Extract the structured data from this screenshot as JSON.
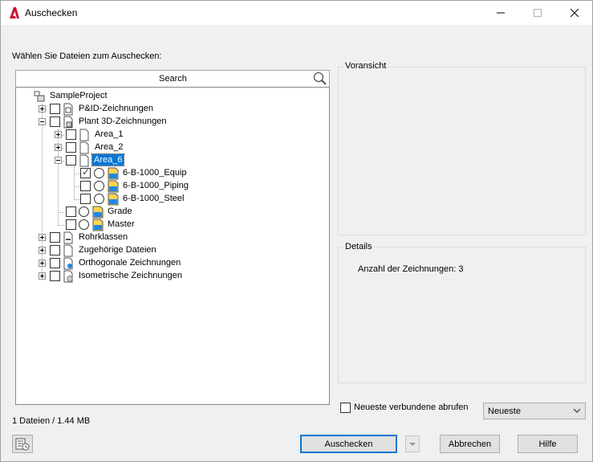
{
  "window": {
    "title": "Auschecken",
    "accent_color": "#0078d7",
    "brand_color": "#c8102e"
  },
  "left": {
    "prompt": "Wählen Sie Dateien zum Auschecken:",
    "search_label": "Search",
    "status": "1 Dateien / 1.44 MB"
  },
  "tree": {
    "root": "SampleProject",
    "pid": "P&ID-Zeichnungen",
    "plant3d": "Plant 3D-Zeichnungen",
    "area1": "Area_1",
    "area2": "Area_2",
    "area6": "Area_6",
    "equip": "6-B-1000_Equip",
    "piping": "6-B-1000_Piping",
    "steel": "6-B-1000_Steel",
    "grade": "Grade",
    "master": "Master",
    "rohr": "Rohrklassen",
    "zugeh": "Zugehörige Dateien",
    "ortho": "Orthogonale Zeichnungen",
    "iso": "Isometrische Zeichnungen",
    "equip_checked": true
  },
  "right": {
    "preview_title": "Voransicht",
    "details_title": "Details",
    "details_text": "Anzahl der Zeichnungen: 3"
  },
  "bottom": {
    "latest_label": "Neueste verbundene abrufen",
    "latest_checked": false,
    "version_selected": "Neueste",
    "checkout_button": "Auschecken",
    "cancel_button": "Abbrechen",
    "help_button": "Hilfe"
  }
}
